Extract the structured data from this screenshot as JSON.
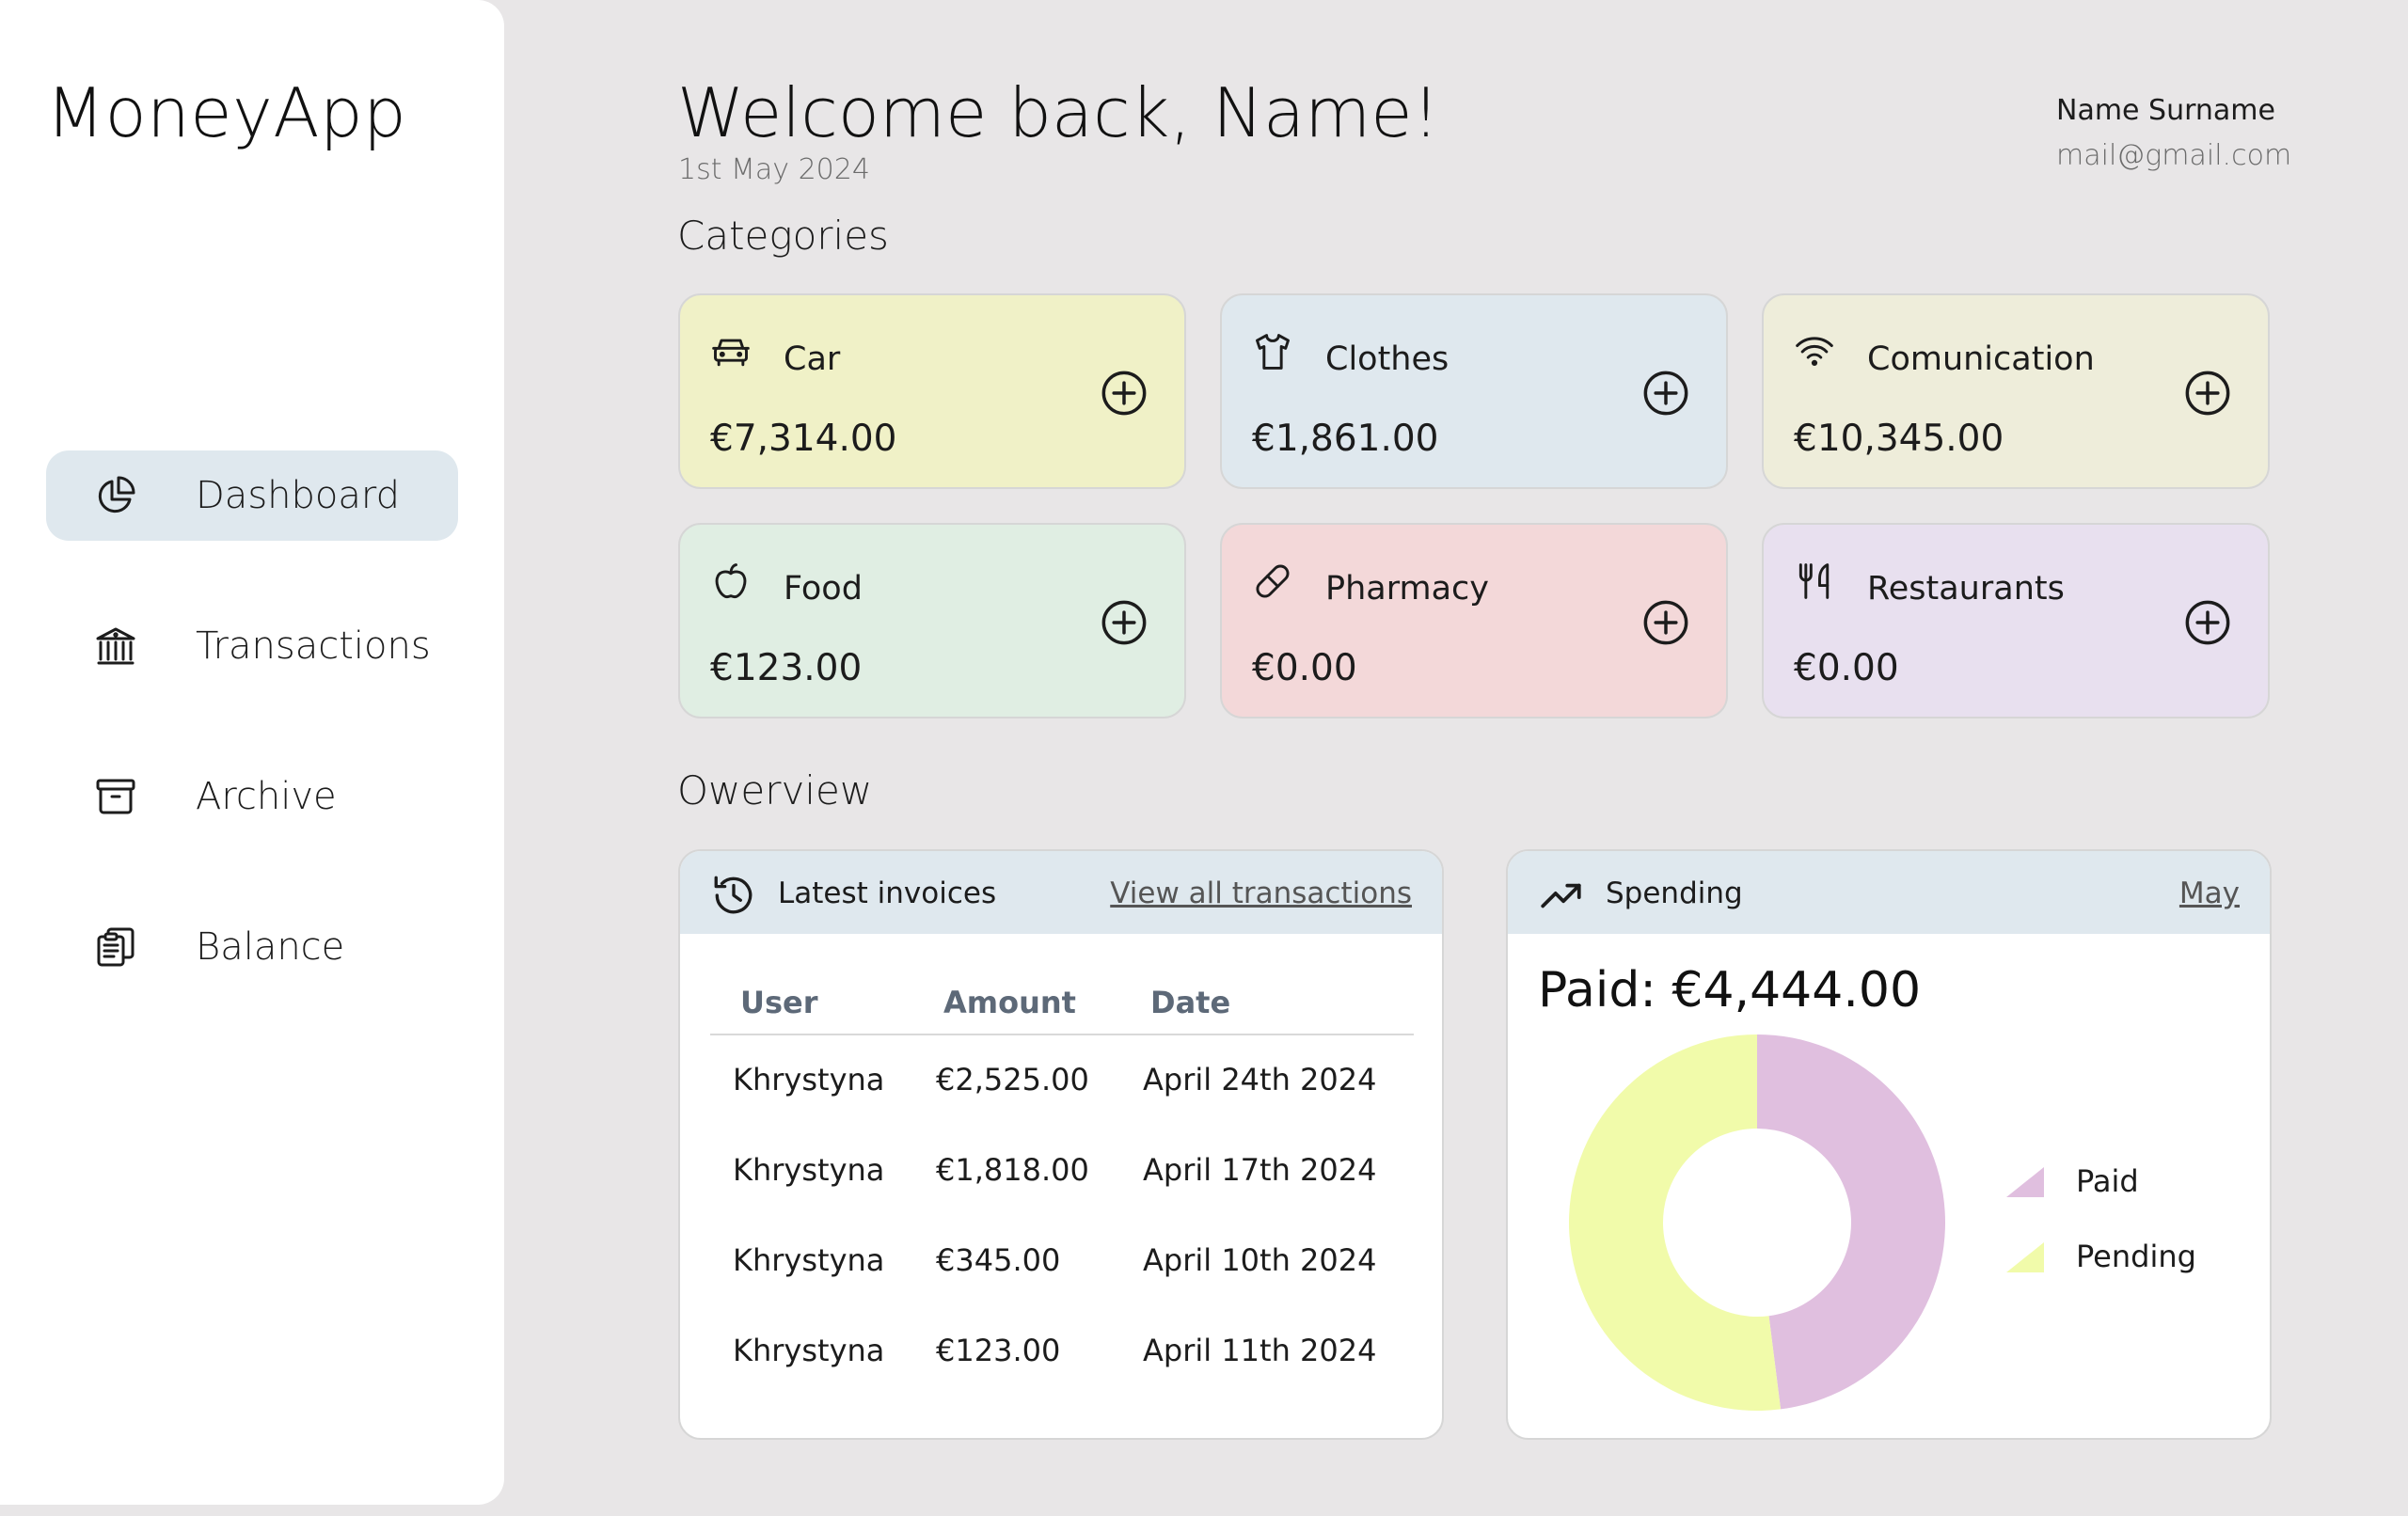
{
  "app": {
    "title": "MoneyApp"
  },
  "sidebar": {
    "items": [
      {
        "label": "Dashboard",
        "icon": "pie-chart-icon",
        "active": true
      },
      {
        "label": "Transactions",
        "icon": "bank-icon",
        "active": false
      },
      {
        "label": "Archive",
        "icon": "archive-box-icon",
        "active": false
      },
      {
        "label": "Balance",
        "icon": "clipboard-icon",
        "active": false
      }
    ]
  },
  "header": {
    "welcome": "Welcome back, Name!",
    "date": "1st May 2024",
    "user_name": "Name Surname",
    "user_email": "mail@gmail.com"
  },
  "categories": {
    "title": "Categories",
    "items": [
      {
        "name": "Car",
        "amount": "€7,314.00",
        "icon": "car-icon",
        "color": "#f0f1c7"
      },
      {
        "name": "Clothes",
        "amount": "€1,861.00",
        "icon": "shirt-icon",
        "color": "#dfe8ee"
      },
      {
        "name": "Comunication",
        "amount": "€10,345.00",
        "icon": "wifi-icon",
        "color": "#eeedda"
      },
      {
        "name": "Food",
        "amount": "€123.00",
        "icon": "apple-icon",
        "color": "#e0eee3"
      },
      {
        "name": "Pharmacy",
        "amount": "€0.00",
        "icon": "pill-icon",
        "color": "#f3d8d9"
      },
      {
        "name": "Restaurants",
        "amount": "€0.00",
        "icon": "fork-knife-icon",
        "color": "#e8e0ef"
      }
    ]
  },
  "overview": {
    "title": "Owerview",
    "invoices": {
      "title": "Latest invoices",
      "link": "View all transactions",
      "columns": [
        "User",
        "Amount",
        "Date"
      ],
      "rows": [
        [
          "Khrystyna",
          "€2,525.00",
          "April 24th 2024"
        ],
        [
          "Khrystyna",
          "€1,818.00",
          "April 17th 2024"
        ],
        [
          "Khrystyna",
          "€345.00",
          "April 10th 2024"
        ],
        [
          "Khrystyna",
          "€123.00",
          "April 11th 2024"
        ]
      ]
    },
    "spending": {
      "title": "Spending",
      "period": "May",
      "paid_label": "Paid: €4,444.00"
    }
  },
  "chart_data": {
    "type": "pie",
    "labels": [
      "Paid",
      "Pending"
    ],
    "values": [
      48,
      52
    ],
    "colors": [
      "#e0bfdf",
      "#f1fbaa"
    ],
    "donut": true,
    "legend": "right"
  }
}
